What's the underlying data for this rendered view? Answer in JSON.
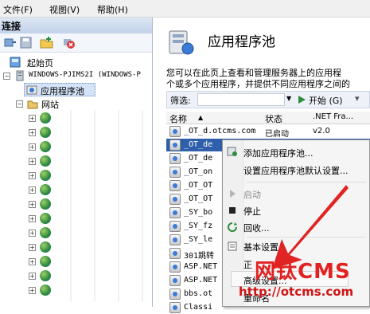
{
  "menu": {
    "file": "文件(F)",
    "view": "视图(V)",
    "help": "帮助(H)"
  },
  "connections": {
    "header": "连接",
    "start_page": "起始页",
    "server": "WINDOWS-PJIMS2I (WINDOWS-P",
    "app_pools": "应用程序池",
    "sites": "网站"
  },
  "main": {
    "title": "应用程序池",
    "description_line1": "您可以在此页上查看和管理服务器上的应用程",
    "description_line2": "个或多个应用程序，并提供不同应用程序之间的",
    "filter_label": "筛选:",
    "start_button": "开始 (G)",
    "columns": {
      "name": "名称",
      "status": "状态",
      "netfx": ".NET Fra..."
    }
  },
  "pools": [
    {
      "name": "_OT_d.otcms.com",
      "status": "已启动",
      "netfx": "v2.0"
    },
    {
      "name": "_OT_de",
      "status": "",
      "netfx": ""
    },
    {
      "name": "_OT_de",
      "status": "",
      "netfx": ""
    },
    {
      "name": "_OT_on",
      "status": "",
      "netfx": ""
    },
    {
      "name": "_OT_OT",
      "status": "",
      "netfx": ""
    },
    {
      "name": "_OT_OT",
      "status": "",
      "netfx": ""
    },
    {
      "name": "_SY_bo",
      "status": "",
      "netfx": ""
    },
    {
      "name": "_SY_fz",
      "status": "",
      "netfx": ""
    },
    {
      "name": "_SY_le",
      "status": "",
      "netfx": ""
    },
    {
      "name": "301跳转",
      "status": "",
      "netfx": ""
    },
    {
      "name": "ASP.NET",
      "status": "",
      "netfx": ""
    },
    {
      "name": "ASP.NET",
      "status": "",
      "netfx": ""
    },
    {
      "name": "bbs.ot",
      "status": "",
      "netfx": ""
    },
    {
      "name": "Classi",
      "status": "",
      "netfx": ""
    }
  ],
  "context_menu": {
    "add_pool": "添加应用程序池...",
    "set_defaults": "设置应用程序池默认设置...",
    "start": "启动",
    "stop": "停止",
    "recycle": "回收...",
    "basic_settings": "基本设置...",
    "advanced_settings_partial": "正",
    "advanced_settings": "高级设置...",
    "rename": "重命名"
  },
  "watermark": {
    "brand": "网钛CMS",
    "url": "http://otcms.com"
  },
  "colors": {
    "selection": "#2f5fab",
    "watermark": "#e22121"
  }
}
